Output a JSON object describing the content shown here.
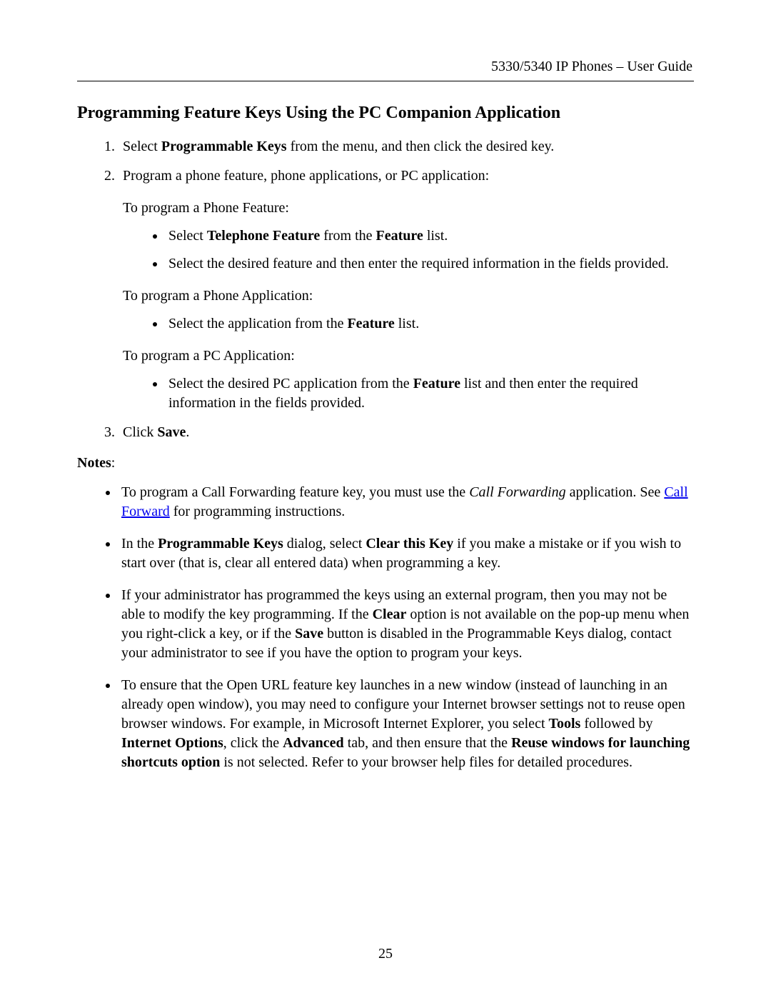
{
  "header": {
    "running_title": "5330/5340 IP Phones – User Guide"
  },
  "section": {
    "title": "Programming Feature Keys Using the PC Companion Application"
  },
  "step1": {
    "pre": "Select ",
    "bold": "Programmable Keys",
    "post": " from the menu, and then click the desired key."
  },
  "step2_intro": "Program a phone feature, phone applications, or PC application:",
  "phone_feature_intro": "To program a Phone Feature:",
  "pf_b1": {
    "pre": "Select ",
    "b1": "Telephone Feature",
    "mid": " from the ",
    "b2": "Feature",
    "post": " list."
  },
  "pf_b2": "Select the desired feature and then enter the required information in the fields provided.",
  "phone_app_intro": "To program a Phone Application:",
  "pa_b1": {
    "pre": "Select the application from the ",
    "b1": "Feature",
    "post": " list."
  },
  "pc_app_intro": "To program a PC Application:",
  "pc_b1": {
    "pre": "Select the desired PC application from the ",
    "b1": "Feature",
    "post": " list and then enter the required information in the fields provided."
  },
  "step3": {
    "pre": "Click ",
    "b1": "Save",
    "post": "."
  },
  "notes_label": "Notes",
  "n1": {
    "pre": "To program a Call Forwarding feature key, you must use the ",
    "italic": "Call Forwarding",
    "mid": " application. See ",
    "link": "Call Forward",
    "post": " for programming instructions."
  },
  "n2": {
    "pre": "In the ",
    "b1": "Programmable Keys",
    "mid1": " dialog, select ",
    "b2": "Clear this Key",
    "post": " if you make a mistake or if you wish to start over (that is, clear all entered data) when programming a key."
  },
  "n3": {
    "pre": "If your administrator has programmed the keys using an external program, then you may not be able to modify the key programming. If the ",
    "b1": "Clear",
    "mid1": " option is not available on the pop-up menu when you right-click a key, or if the ",
    "b2": "Save",
    "post": " button is disabled in the Programmable Keys dialog, contact your administrator to see if you have the option to program your keys."
  },
  "n4": {
    "pre": "To ensure that the Open URL feature key launches in a new window (instead of launching in an already open window), you may need to configure your Internet browser settings not to reuse open browser windows. For example, in Microsoft Internet Explorer, you select ",
    "b1": "Tools",
    "mid1": " followed by ",
    "b2": "Internet Options",
    "mid2": ", click the ",
    "b3": "Advanced",
    "mid3": " tab, and then ensure that the ",
    "b4": "Reuse windows for launching shortcuts option",
    "post": " is not selected. Refer to your browser help files for detailed procedures."
  },
  "page_number": "25"
}
